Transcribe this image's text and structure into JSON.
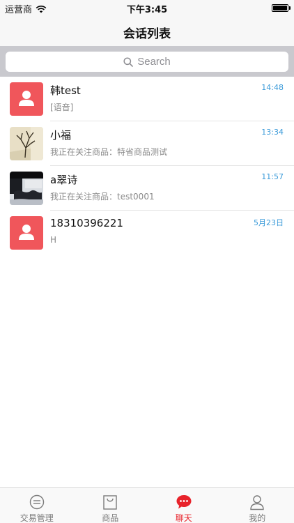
{
  "status_bar": {
    "carrier": "运营商",
    "time": "下午3:45"
  },
  "nav": {
    "title": "会话列表"
  },
  "search": {
    "placeholder": "Search"
  },
  "conversations": [
    {
      "name": "韩test",
      "message": "[语音]",
      "time": "14:48",
      "avatar": "default-person-icon"
    },
    {
      "name": "小福",
      "message": "我正在关注商品：特省商品测试",
      "time": "13:34",
      "avatar": "tree-photo"
    },
    {
      "name": "a翠诗",
      "message": "我正在关注商品：test0001",
      "time": "11:57",
      "avatar": "product-photo"
    },
    {
      "name": "18310396221",
      "message": "H",
      "time": "5月23日",
      "avatar": "default-person-icon"
    }
  ],
  "tabs": [
    {
      "label": "交易管理",
      "icon": "trade-icon",
      "active": false
    },
    {
      "label": "商品",
      "icon": "bag-icon",
      "active": false
    },
    {
      "label": "聊天",
      "icon": "chat-icon",
      "active": true
    },
    {
      "label": "我的",
      "icon": "user-icon",
      "active": false
    }
  ],
  "colors": {
    "accent": "#e8232b",
    "time": "#3a9ad9",
    "avatar_default": "#f0565b"
  }
}
